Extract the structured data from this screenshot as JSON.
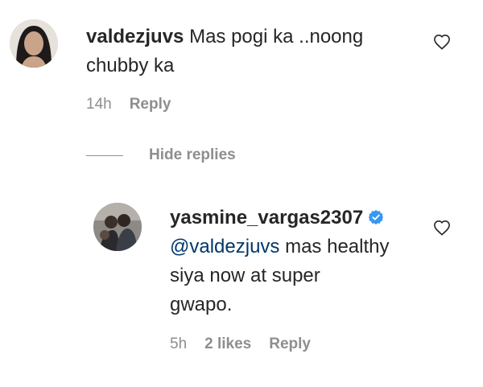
{
  "comment": {
    "username": "valdezjuvs",
    "text_line1": "Mas pogi ka ..noong",
    "text_line2": "chubby ka",
    "time": "14h",
    "reply_label": "Reply"
  },
  "thread": {
    "hide_replies_label": "Hide replies"
  },
  "reply": {
    "username": "yasmine_vargas2307",
    "verified": true,
    "mention": "@valdezjuvs",
    "text_line1_rest": " mas healthy",
    "text_line2": "siya now at super",
    "text_line3": "gwapo.",
    "time": "5h",
    "likes": "2 likes",
    "reply_label": "Reply"
  },
  "colors": {
    "text": "#262626",
    "secondary": "#8e8e8e",
    "mention": "#00376b",
    "verified": "#3897f0"
  },
  "icons": [
    "heart-outline-icon",
    "verified-badge-icon"
  ]
}
